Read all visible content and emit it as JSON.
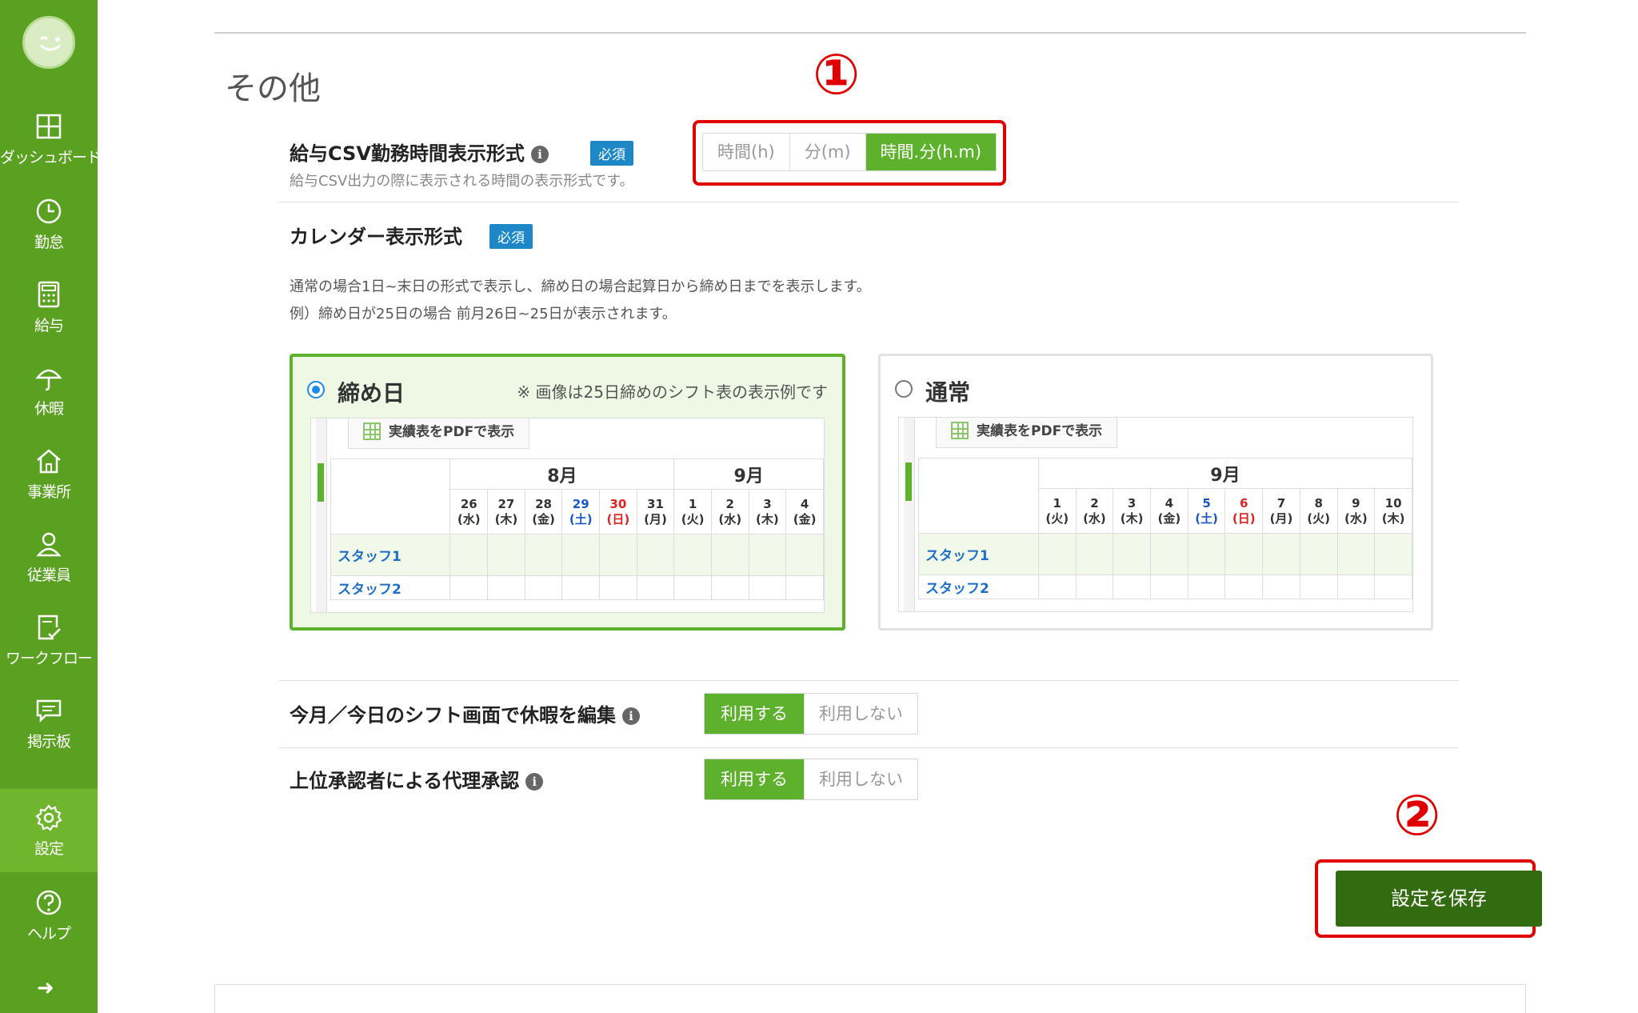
{
  "sidebar": {
    "items": [
      {
        "label": "ダッシュボード",
        "icon": "dashboard-icon"
      },
      {
        "label": "勤怠",
        "icon": "clock-icon"
      },
      {
        "label": "給与",
        "icon": "calculator-icon"
      },
      {
        "label": "休暇",
        "icon": "umbrella-icon"
      },
      {
        "label": "事業所",
        "icon": "home-icon"
      },
      {
        "label": "従業員",
        "icon": "person-icon"
      },
      {
        "label": "ワークフロー",
        "icon": "checklist-icon"
      },
      {
        "label": "掲示板",
        "icon": "chat-icon"
      },
      {
        "label": "設定",
        "icon": "gear-icon"
      },
      {
        "label": "ヘルプ",
        "icon": "help-icon"
      }
    ],
    "active": "設定",
    "expand_glyph": "➜"
  },
  "section": {
    "title": "その他"
  },
  "csv_format": {
    "title": "給与CSV勤務時間表示形式",
    "required": "必須",
    "description": "給与CSV出力の際に表示される時間の表示形式です。",
    "options": [
      "時間(h)",
      "分(m)",
      "時間.分(h.m)"
    ],
    "selected": "時間.分(h.m)"
  },
  "calendar_format": {
    "title": "カレンダー表示形式",
    "required": "必須",
    "description_1": "通常の場合1日~末日の形式で表示し、締め日の場合起算日から締め日までを表示します。",
    "description_2": "例）締め日が25日の場合 前月26日~25日が表示されます。",
    "cards": [
      {
        "title": "締め日",
        "note": "※ 画像は25日締めのシフト表の表示例です",
        "selected": true,
        "pdf_button": "実績表をPDFで表示",
        "months": [
          "8月",
          "9月"
        ],
        "days": [
          {
            "d": "26",
            "w": "(水)"
          },
          {
            "d": "27",
            "w": "(木)"
          },
          {
            "d": "28",
            "w": "(金)"
          },
          {
            "d": "29",
            "w": "(土)"
          },
          {
            "d": "30",
            "w": "(日)"
          },
          {
            "d": "31",
            "w": "(月)"
          },
          {
            "d": "1",
            "w": "(火)"
          },
          {
            "d": "2",
            "w": "(水)"
          },
          {
            "d": "3",
            "w": "(木)"
          },
          {
            "d": "4",
            "w": "(金)"
          }
        ],
        "staff": [
          "スタッフ1",
          "スタッフ2"
        ]
      },
      {
        "title": "通常",
        "selected": false,
        "pdf_button": "実績表をPDFで表示",
        "months": [
          "9月"
        ],
        "days": [
          {
            "d": "1",
            "w": "(火)"
          },
          {
            "d": "2",
            "w": "(水)"
          },
          {
            "d": "3",
            "w": "(木)"
          },
          {
            "d": "4",
            "w": "(金)"
          },
          {
            "d": "5",
            "w": "(土)"
          },
          {
            "d": "6",
            "w": "(日)"
          },
          {
            "d": "7",
            "w": "(月)"
          },
          {
            "d": "8",
            "w": "(火)"
          },
          {
            "d": "9",
            "w": "(水)"
          },
          {
            "d": "10",
            "w": "(木)"
          }
        ],
        "staff": [
          "スタッフ1",
          "スタッフ2"
        ]
      }
    ]
  },
  "shift_edit": {
    "title": "今月／今日のシフト画面で休暇を編集",
    "options": [
      "利用する",
      "利用しない"
    ],
    "selected": "利用する"
  },
  "proxy_approval": {
    "title": "上位承認者による代理承認",
    "options": [
      "利用する",
      "利用しない"
    ],
    "selected": "利用する"
  },
  "annotations": [
    "①",
    "②"
  ],
  "save_button": "設定を保存",
  "colors": {
    "sidebar": "#5aa121",
    "accent": "#5db12c",
    "save": "#336b11",
    "annotation": "#e00000",
    "required": "#1e88c7"
  }
}
